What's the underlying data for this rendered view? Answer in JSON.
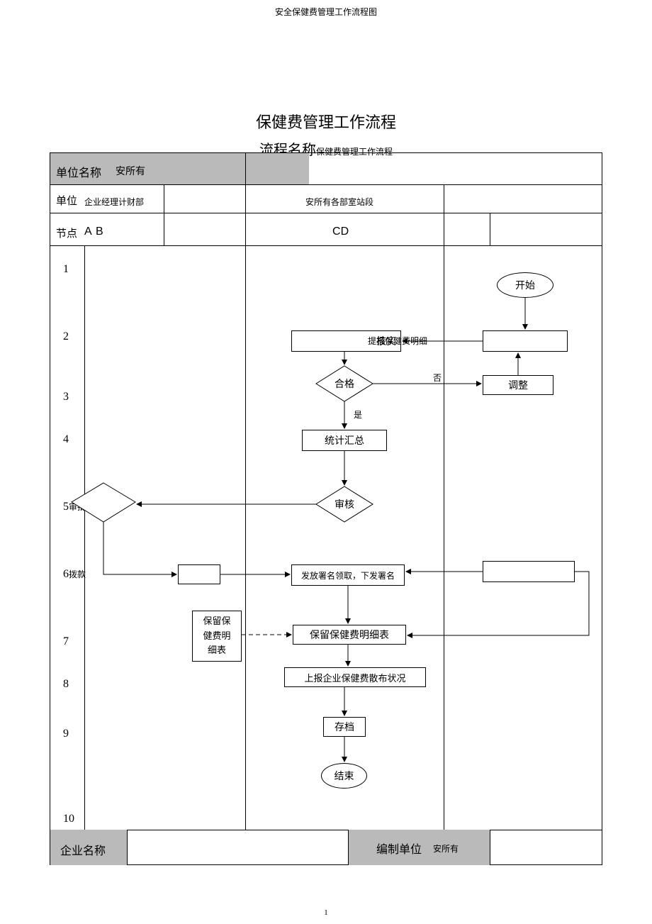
{
  "header_small": "安全保健费管理工作流程图",
  "main_title": "保健费管理工作流程",
  "sub_title_label": "流程名称",
  "sub_title_value": "保健费管理工作流程",
  "row1": {
    "unit_name_label": "单位名称",
    "unit_name_value": "安所有"
  },
  "row2": {
    "unit_label": "单位",
    "unit_value": "企业经理计财部",
    "col_c": "安所有各部室站段"
  },
  "row3": {
    "node_label": "节点",
    "a": "A",
    "b": "B",
    "cd": "C",
    "d": "D"
  },
  "steps": [
    "1",
    "2",
    "3",
    "4",
    "5",
    "6",
    "7",
    "8",
    "9",
    "10"
  ],
  "step_labels": {
    "5": "审批",
    "6": "拨款"
  },
  "nodes": {
    "start": "开始",
    "box2": "核实",
    "box2b": "提报保健费明细",
    "dec_qualified": "合格",
    "dec_no": "否",
    "dec_yes": "是",
    "adjust": "调整",
    "stat": "统计汇总",
    "audit": "审核",
    "issue": "发放署名领取，下发署名",
    "retain_small": "保留保\n健费明\n细表",
    "retain": "保留保健费明细表",
    "report": "上报企业保健费散布状况",
    "archive": "存档",
    "end": "结束"
  },
  "footer": {
    "company_label": "企业名称",
    "compile_unit_label": "编制单位",
    "compile_unit_value": "安所有"
  },
  "page_num": "1"
}
